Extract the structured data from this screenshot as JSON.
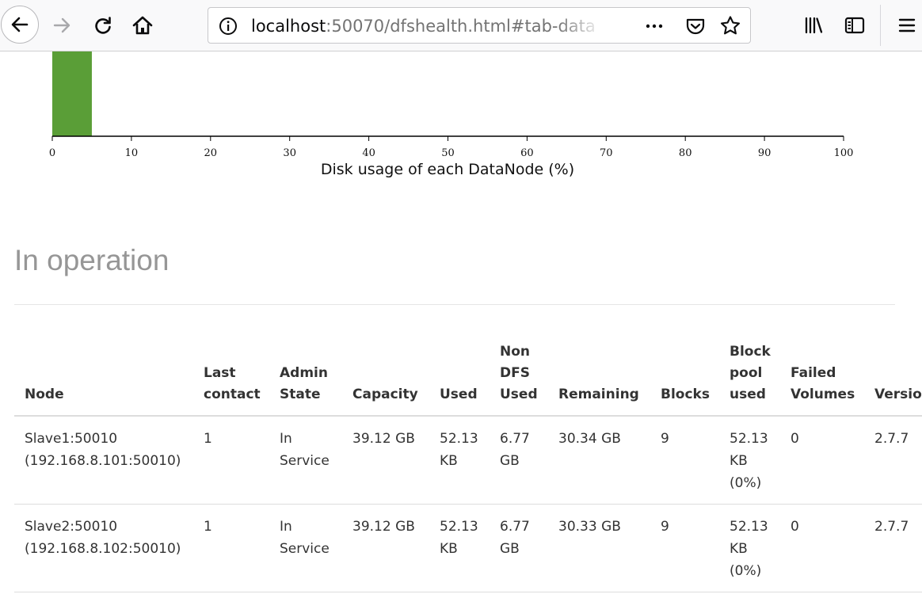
{
  "browser": {
    "url_host": "localhost",
    "url_rest": ":50070/dfshealth.html#tab-data",
    "page_actions_glyph": "•••"
  },
  "chart_data": {
    "type": "bar",
    "xlabel": "Disk usage of each DataNode (%)",
    "xlim": [
      0,
      100
    ],
    "x_ticks": [
      0,
      10,
      20,
      30,
      40,
      50,
      60,
      70,
      80,
      90,
      100
    ],
    "bins": [
      {
        "x0": 0,
        "x1": 5,
        "count": 2
      }
    ],
    "bar_color": "#5a9e37"
  },
  "section": {
    "title": "In operation"
  },
  "table": {
    "headers": [
      "Node",
      "Last\ncontact",
      "Admin\nState",
      "Capacity",
      "Used",
      "Non\nDFS\nUsed",
      "Remaining",
      "Blocks",
      "Block\npool\nused",
      "Failed\nVolumes",
      "Version"
    ],
    "rows": [
      [
        "Slave1:50010\n(192.168.8.101:50010)",
        "1",
        "In\nService",
        "39.12 GB",
        "52.13\nKB",
        "6.77\nGB",
        "30.34 GB",
        "9",
        "52.13\nKB\n(0%)",
        "0",
        "2.7.7"
      ],
      [
        "Slave2:50010\n(192.168.8.102:50010)",
        "1",
        "In\nService",
        "39.12 GB",
        "52.13\nKB",
        "6.77\nGB",
        "30.33 GB",
        "9",
        "52.13\nKB\n(0%)",
        "0",
        "2.7.7"
      ]
    ]
  }
}
